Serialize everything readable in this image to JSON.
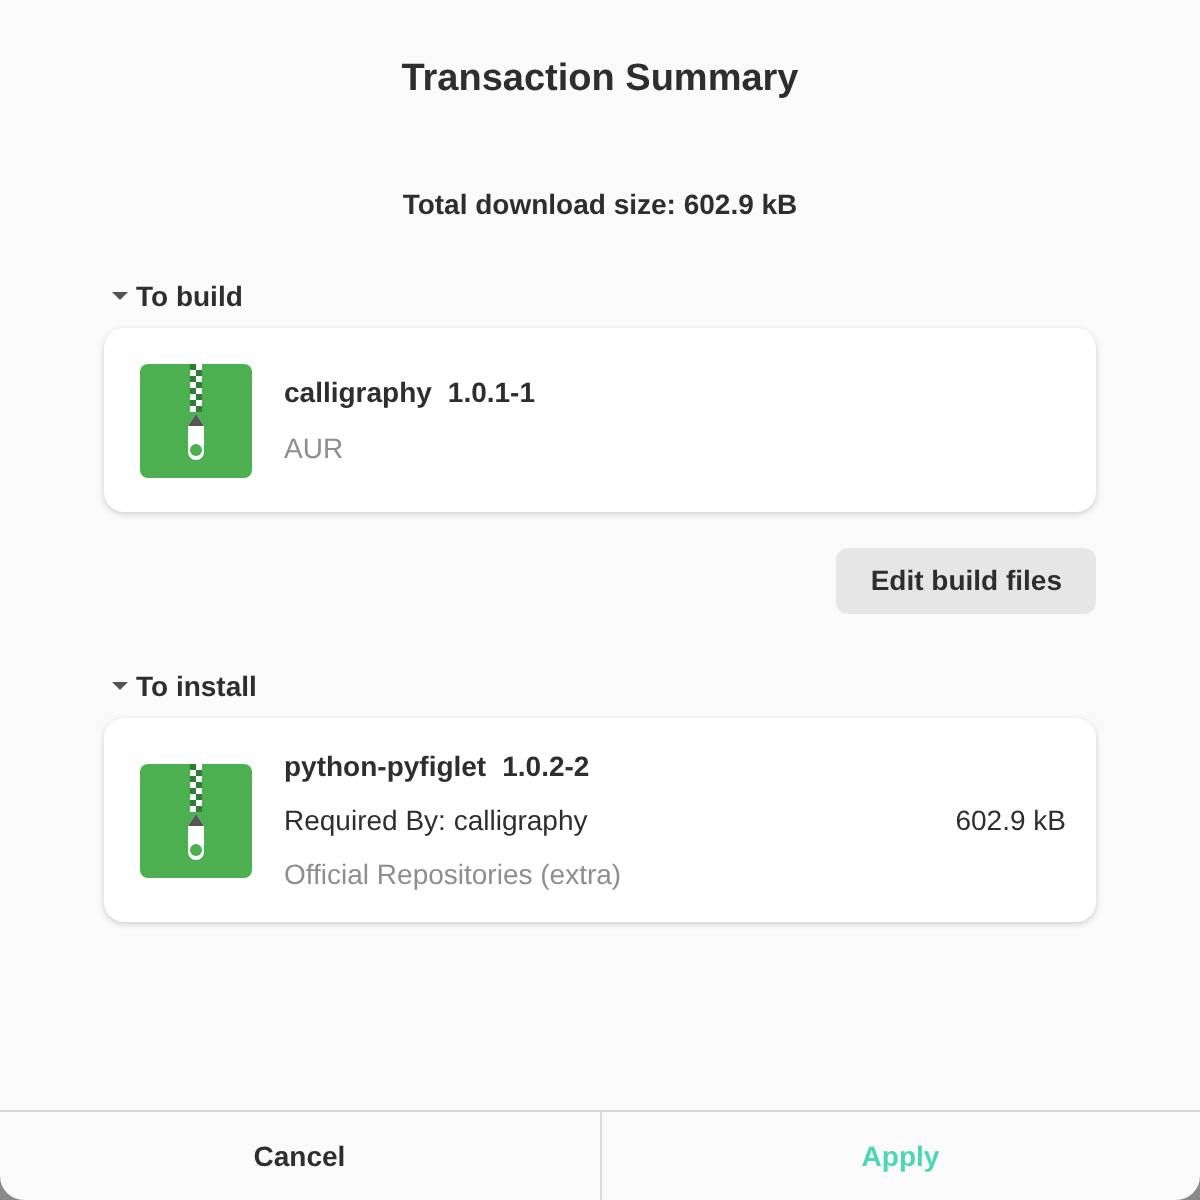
{
  "window": {
    "title": "Transaction Summary"
  },
  "total": "Total download size: 602.9 kB",
  "sections": [
    {
      "title": "To build",
      "expanded": true,
      "packages": [
        {
          "name": "calligraphy",
          "version": "1.0.1-1",
          "lines": [
            {
              "kind": "source",
              "text": "AUR"
            }
          ]
        }
      ],
      "actions": [
        "Edit build files"
      ]
    },
    {
      "title": "To install",
      "expanded": true,
      "packages": [
        {
          "name": "python-pyfiglet",
          "version": "1.0.2-2",
          "lines": [
            {
              "kind": "detail",
              "text": "Required By: calligraphy"
            },
            {
              "kind": "source",
              "text": "Official Repositories (extra)"
            }
          ],
          "size": "602.9 kB"
        }
      ]
    }
  ],
  "buttons": [
    {
      "label": "Cancel",
      "kind": "cancel"
    },
    {
      "label": "Apply",
      "kind": "suggested"
    }
  ]
}
